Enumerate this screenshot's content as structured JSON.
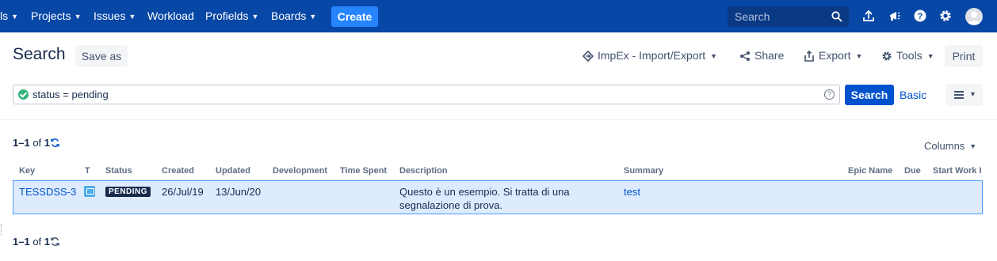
{
  "topnav": {
    "partial_item": "ls",
    "items": [
      {
        "label": "Projects",
        "has_menu": true
      },
      {
        "label": "Issues",
        "has_menu": true
      },
      {
        "label": "Workload",
        "has_menu": false
      },
      {
        "label": "Profields",
        "has_menu": true
      },
      {
        "label": "Boards",
        "has_menu": true
      }
    ],
    "create_label": "Create",
    "search_placeholder": "Search"
  },
  "header": {
    "title": "Search",
    "save_as": "Save as",
    "impex": "ImpEx - Import/Export",
    "share": "Share",
    "export": "Export",
    "tools": "Tools",
    "print": "Print"
  },
  "jql": {
    "query": "status = pending",
    "search_button": "Search",
    "basic_link": "Basic"
  },
  "results": {
    "count_range": "1–1",
    "count_of": "of",
    "count_total": "1",
    "columns_label": "Columns"
  },
  "table": {
    "headers": {
      "key": "Key",
      "type": "T",
      "status": "Status",
      "created": "Created",
      "updated": "Updated",
      "development": "Development",
      "time_spent": "Time Spent",
      "description": "Description",
      "summary": "Summary",
      "epic_name": "Epic Name",
      "due": "Due",
      "start_work": "Start Work I"
    },
    "rows": [
      {
        "key": "TESSDSS-3",
        "type_icon": "task-icon",
        "status": "PENDING",
        "created": "26/Jul/19",
        "updated": "13/Jun/20",
        "description_line1": "Questo è un esempio. Si tratta di una",
        "description_line2": "segnalazione di prova.",
        "summary": "test"
      }
    ]
  },
  "colors": {
    "nav_bg": "#0747a6",
    "create_bg": "#2684ff",
    "primary": "#0052cc",
    "row_selected": "#deebff",
    "status_lozenge": "#172b4d"
  }
}
